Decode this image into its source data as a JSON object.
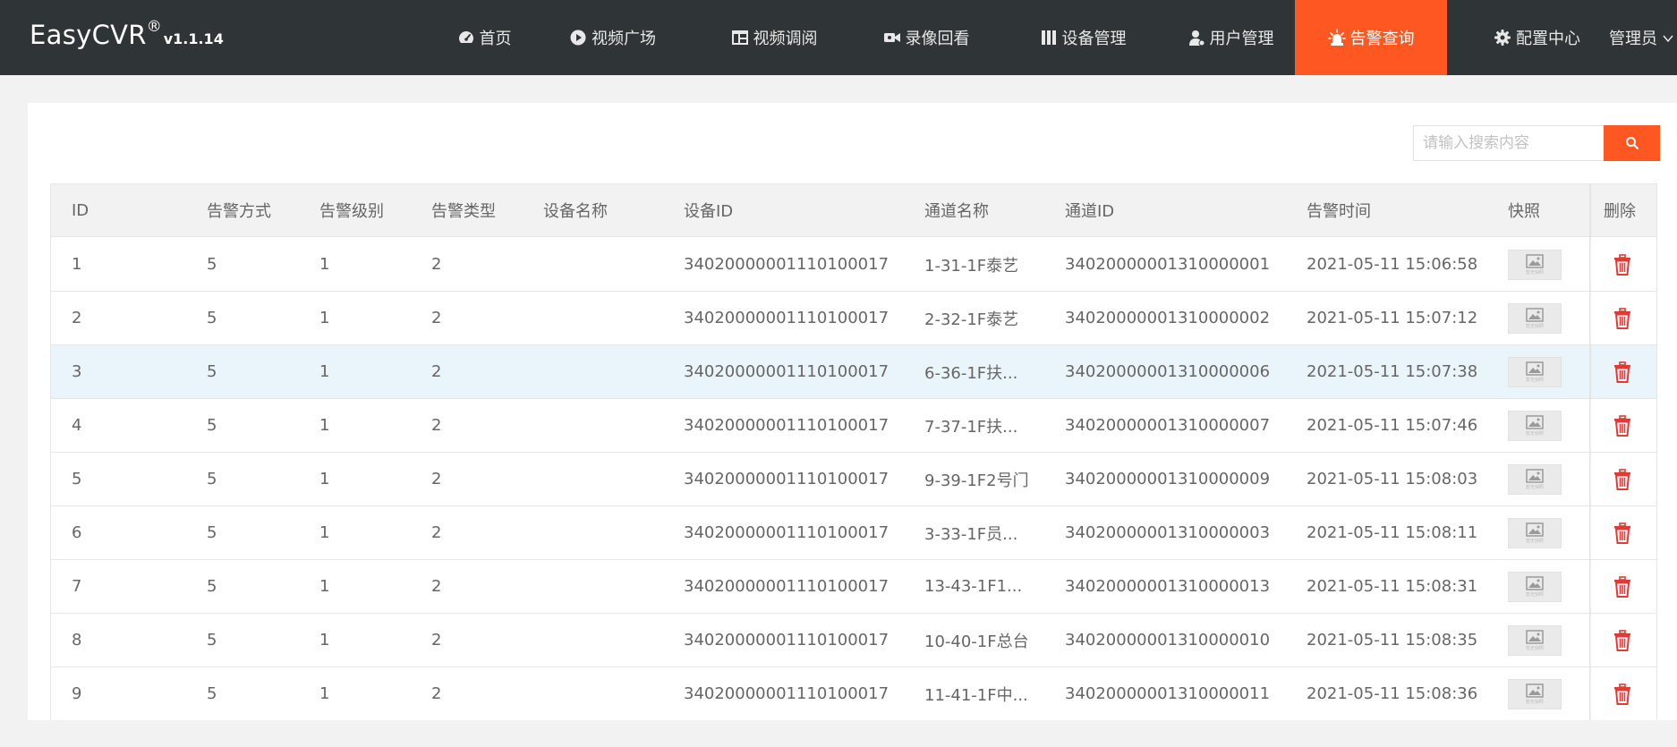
{
  "app": {
    "brand": "EasyCVR",
    "brand_reg": "®",
    "version": "v1.1.14"
  },
  "nav": {
    "items": [
      {
        "label": "首页",
        "icon": "dashboard-icon"
      },
      {
        "label": "视频广场",
        "icon": "play-circle-icon"
      },
      {
        "label": "视频调阅",
        "icon": "layout-icon"
      },
      {
        "label": "录像回看",
        "icon": "video-camera-icon"
      },
      {
        "label": "设备管理",
        "icon": "device-icon"
      },
      {
        "label": "用户管理",
        "icon": "user-icon"
      },
      {
        "label": "告警查询",
        "icon": "alarm-icon",
        "active": true
      },
      {
        "label": "配置中心",
        "icon": "gear-icon"
      }
    ],
    "user_label": "管理员"
  },
  "search": {
    "placeholder": "请输入搜索内容",
    "value": ""
  },
  "colors": {
    "accent": "#ff5722",
    "topbar": "#2f3436",
    "delete": "#e53935",
    "highlight_row": "#eaf5fb"
  },
  "table": {
    "headers": [
      "ID",
      "告警方式",
      "告警级别",
      "告警类型",
      "设备名称",
      "设备ID",
      "通道名称",
      "通道ID",
      "告警时间",
      "快照",
      "删除"
    ],
    "snapshot_placeholder": "暂无快照",
    "highlighted_row": 3,
    "rows": [
      {
        "id": "1",
        "method": "5",
        "level": "1",
        "type": "2",
        "device_name": "",
        "device_id": "34020000001110100017",
        "channel_name": "1-31-1F泰艺",
        "channel_id": "34020000001310000001",
        "time": "2021-05-11 15:06:58"
      },
      {
        "id": "2",
        "method": "5",
        "level": "1",
        "type": "2",
        "device_name": "",
        "device_id": "34020000001110100017",
        "channel_name": "2-32-1F泰艺",
        "channel_id": "34020000001310000002",
        "time": "2021-05-11 15:07:12"
      },
      {
        "id": "3",
        "method": "5",
        "level": "1",
        "type": "2",
        "device_name": "",
        "device_id": "34020000001110100017",
        "channel_name": "6-36-1F扶...",
        "channel_id": "34020000001310000006",
        "time": "2021-05-11 15:07:38"
      },
      {
        "id": "4",
        "method": "5",
        "level": "1",
        "type": "2",
        "device_name": "",
        "device_id": "34020000001110100017",
        "channel_name": "7-37-1F扶...",
        "channel_id": "34020000001310000007",
        "time": "2021-05-11 15:07:46"
      },
      {
        "id": "5",
        "method": "5",
        "level": "1",
        "type": "2",
        "device_name": "",
        "device_id": "34020000001110100017",
        "channel_name": "9-39-1F2号门",
        "channel_id": "34020000001310000009",
        "time": "2021-05-11 15:08:03"
      },
      {
        "id": "6",
        "method": "5",
        "level": "1",
        "type": "2",
        "device_name": "",
        "device_id": "34020000001110100017",
        "channel_name": "3-33-1F员...",
        "channel_id": "34020000001310000003",
        "time": "2021-05-11 15:08:11"
      },
      {
        "id": "7",
        "method": "5",
        "level": "1",
        "type": "2",
        "device_name": "",
        "device_id": "34020000001110100017",
        "channel_name": "13-43-1F1...",
        "channel_id": "34020000001310000013",
        "time": "2021-05-11 15:08:31"
      },
      {
        "id": "8",
        "method": "5",
        "level": "1",
        "type": "2",
        "device_name": "",
        "device_id": "34020000001110100017",
        "channel_name": "10-40-1F总台",
        "channel_id": "34020000001310000010",
        "time": "2021-05-11 15:08:35"
      },
      {
        "id": "9",
        "method": "5",
        "level": "1",
        "type": "2",
        "device_name": "",
        "device_id": "34020000001110100017",
        "channel_name": "11-41-1F中...",
        "channel_id": "34020000001310000011",
        "time": "2021-05-11 15:08:36"
      }
    ]
  }
}
